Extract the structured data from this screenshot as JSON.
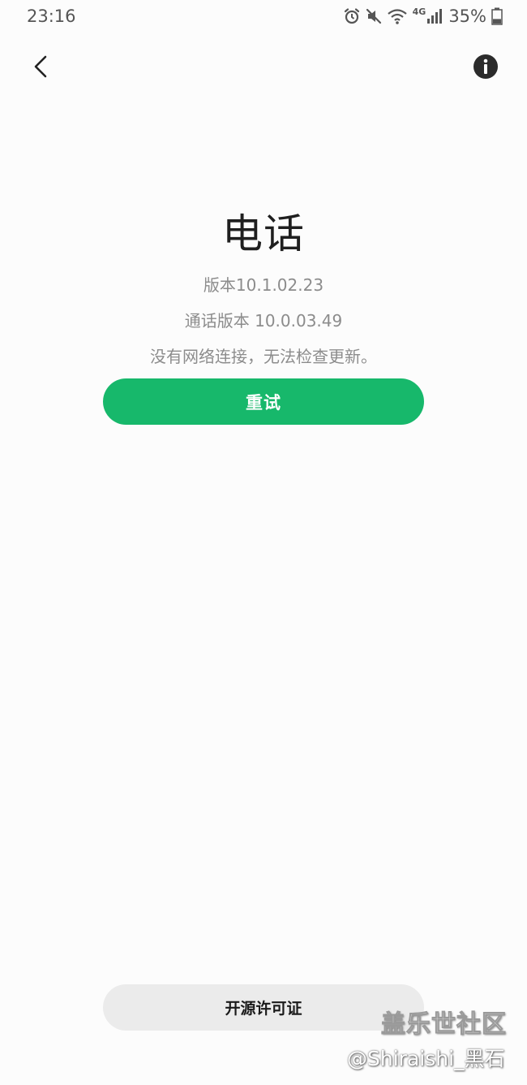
{
  "status_bar": {
    "time": "23:16",
    "battery_percent": "35%",
    "battery_level": 0.35,
    "network_label": "4G",
    "icons": [
      "alarm-icon",
      "mute-icon",
      "wifi-icon",
      "signal-icon",
      "battery-icon"
    ]
  },
  "header": {
    "back_icon": "chevron-left-icon",
    "info_icon": "info-icon"
  },
  "app": {
    "title": "电话",
    "version": "版本10.1.02.23",
    "call_version": "通话版本 10.0.03.49",
    "network_message": "没有网络连接，无法检查更新。"
  },
  "buttons": {
    "retry_label": "重试",
    "license_label": "开源许可证"
  },
  "watermark": {
    "forum": "盖乐世社区",
    "user": "@Shiraishi_黑石"
  },
  "colors": {
    "accent": "#17b86b",
    "background": "#fcfcfc",
    "secondary_text": "#8c8c8c",
    "license_button_bg": "#ebebeb"
  }
}
